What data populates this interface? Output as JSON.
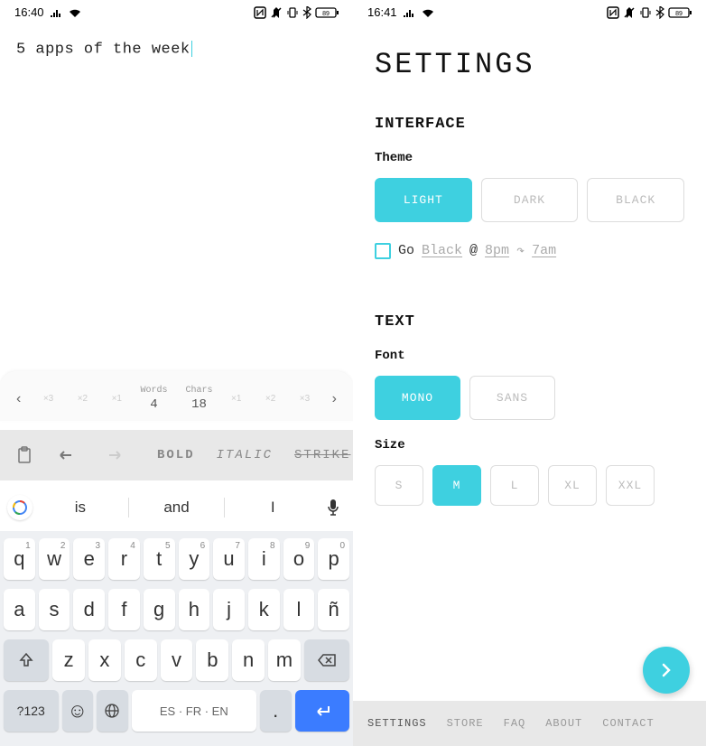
{
  "left": {
    "status": {
      "time": "16:40",
      "battery": "89"
    },
    "editor": {
      "text": "5 apps of the week"
    },
    "wordcount": {
      "words_label": "Words",
      "words": "4",
      "chars_label": "Chars",
      "chars": "18",
      "mults": [
        "×3",
        "×2",
        "×1",
        "×1",
        "×2",
        "×3"
      ]
    },
    "toolbar": {
      "bold": "BOLD",
      "italic": "ITALIC",
      "strike": "STRIKE"
    },
    "keyboard": {
      "suggestions": [
        "is",
        "and",
        "I"
      ],
      "row1": [
        [
          "q",
          "1"
        ],
        [
          "w",
          "2"
        ],
        [
          "e",
          "3"
        ],
        [
          "r",
          "4"
        ],
        [
          "t",
          "5"
        ],
        [
          "y",
          "6"
        ],
        [
          "u",
          "7"
        ],
        [
          "i",
          "8"
        ],
        [
          "o",
          "9"
        ],
        [
          "p",
          "0"
        ]
      ],
      "row2": [
        "a",
        "s",
        "d",
        "f",
        "g",
        "h",
        "j",
        "k",
        "l",
        "ñ"
      ],
      "row3": [
        "z",
        "x",
        "c",
        "v",
        "b",
        "n",
        "m"
      ],
      "sym": "?123",
      "space": "ES · FR · EN",
      "period": "."
    }
  },
  "right": {
    "status": {
      "time": "16:41",
      "battery": "89"
    },
    "title": "SETTINGS",
    "interface": {
      "heading": "INTERFACE",
      "theme_label": "Theme",
      "themes": [
        "LIGHT",
        "DARK",
        "BLACK"
      ],
      "go_label": "Go",
      "black_link": "Black",
      "at": "@",
      "time1": "8pm",
      "time2": "7am"
    },
    "text": {
      "heading": "TEXT",
      "font_label": "Font",
      "fonts": [
        "MONO",
        "SANS"
      ],
      "size_label": "Size",
      "sizes": [
        "S",
        "M",
        "L",
        "XL",
        "XXL"
      ]
    },
    "nav": [
      "SETTINGS",
      "STORE",
      "FAQ",
      "ABOUT",
      "CONTACT"
    ]
  }
}
